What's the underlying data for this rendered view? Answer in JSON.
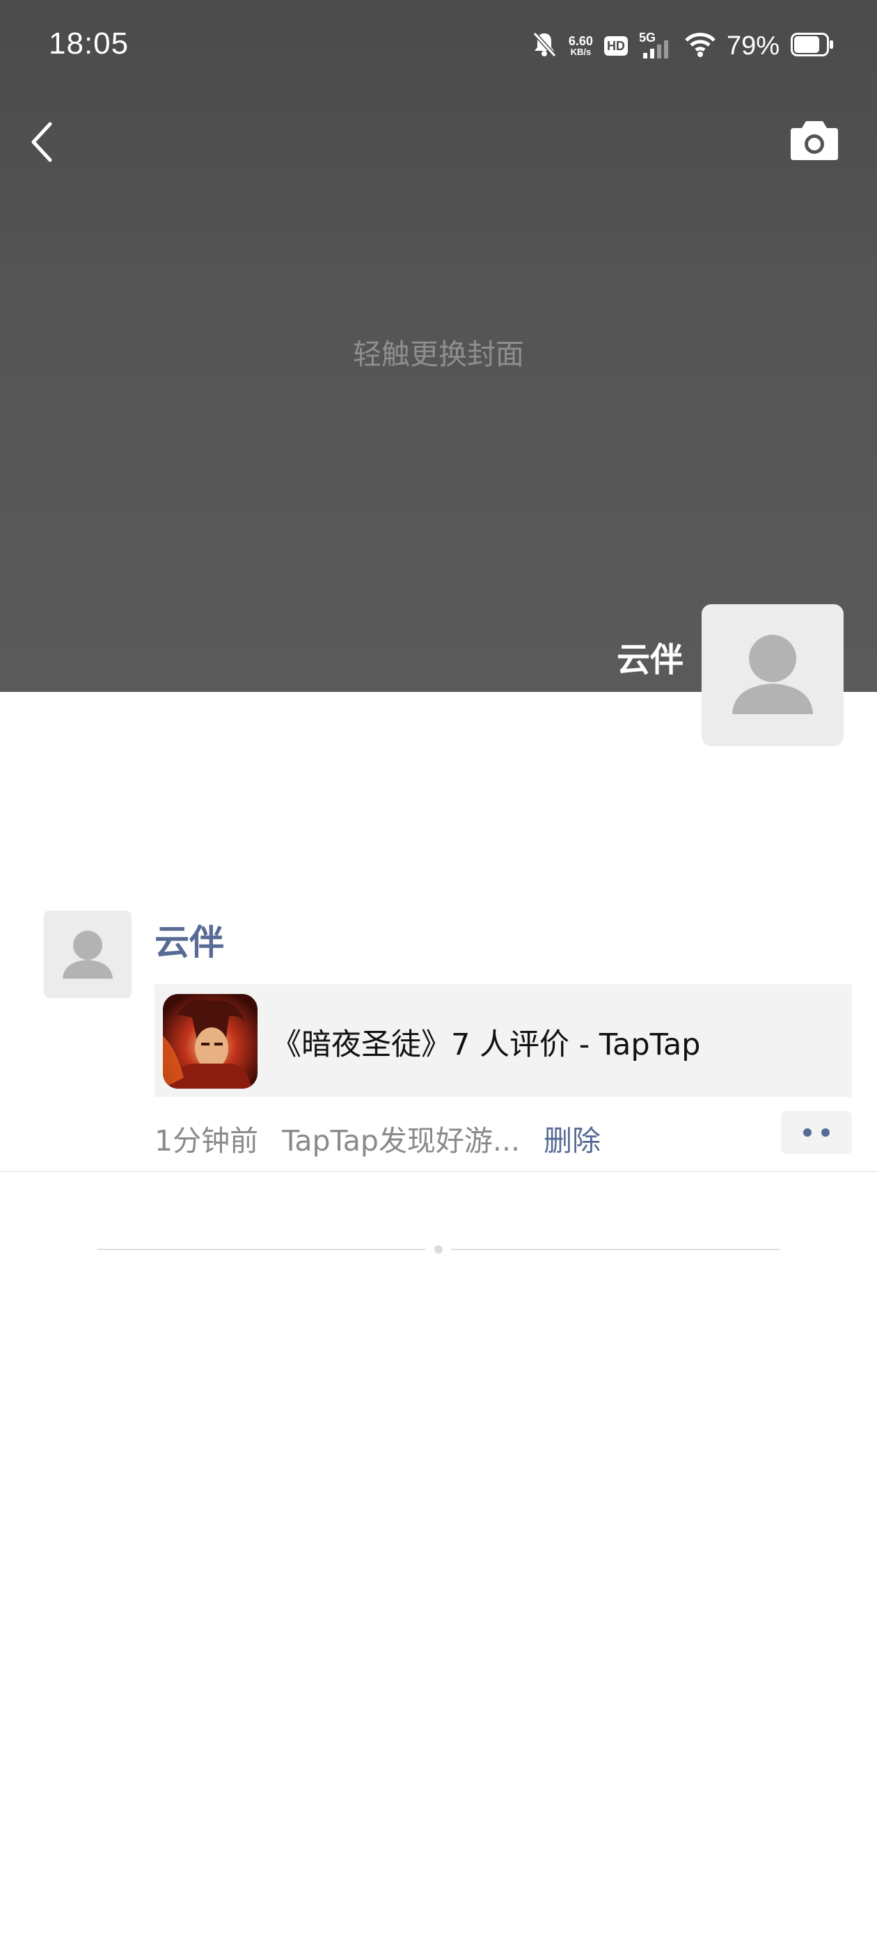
{
  "status_bar": {
    "time": "18:05",
    "net_speed_value": "6.60",
    "net_speed_unit": "KB/s",
    "hd_badge": "HD",
    "signal_label": "5G",
    "battery_percent": "79%",
    "battery_level": 0.79,
    "icons": [
      "mute-bell-icon",
      "signal-icon",
      "wifi-icon",
      "battery-icon"
    ]
  },
  "header": {
    "back_icon": "chevron-left-icon",
    "camera_icon": "camera-icon"
  },
  "cover": {
    "hint": "轻触更换封面",
    "user_name": "云伴"
  },
  "post": {
    "author": "云伴",
    "share_title": "《暗夜圣徒》7 人评价 - TapTap",
    "time": "1分钟前",
    "source": "TapTap发现好游...",
    "delete_label": "删除"
  },
  "colors": {
    "link_blue": "#576b95",
    "cover_gray": "#545454",
    "meta_gray": "#8a8a8a",
    "card_bg": "#f3f3f3"
  }
}
